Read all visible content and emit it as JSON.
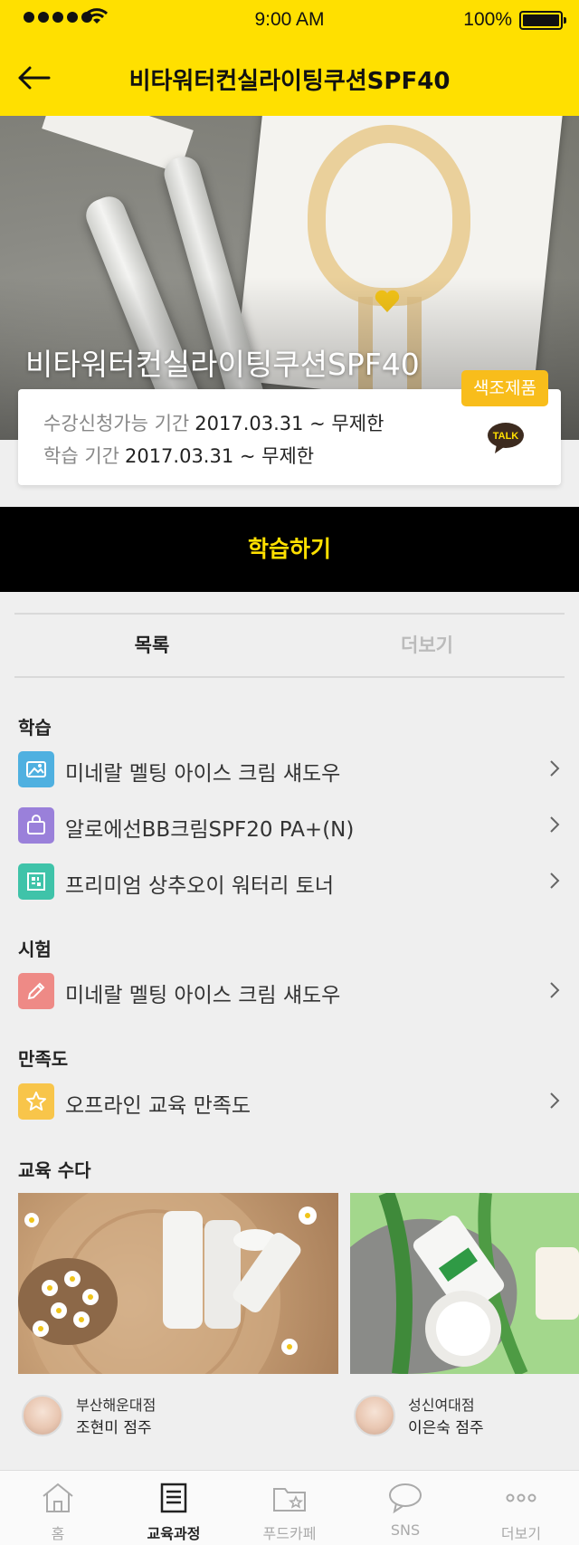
{
  "status_bar": {
    "time": "9:00 AM",
    "battery": "100%"
  },
  "nav": {
    "title": "비타워터컨실라이팅쿠션SPF40"
  },
  "hero": {
    "title": "비타워터컨실라이팅쿠션SPF40",
    "badge": "색조제품",
    "talk_label": "TALK"
  },
  "info": {
    "apply_period_label": "수강신청가능 기간",
    "apply_period_value": "2017.03.31 ~ 무제한",
    "study_period_label": "학습 기간",
    "study_period_value": "2017.03.31 ~ 무제한"
  },
  "cta": {
    "label": "학습하기"
  },
  "tabs": [
    {
      "label": "목록",
      "active": true
    },
    {
      "label": "더보기",
      "active": false
    }
  ],
  "sections": {
    "study": {
      "title": "학습",
      "items": [
        {
          "label": "미네랄 멜팅 아이스 크림 섀도우",
          "icon": "image-icon",
          "color": "#4fb0e0"
        },
        {
          "label": "알로에선BB크림SPF20 PA+(N)",
          "icon": "bag-icon",
          "color": "#9a80da"
        },
        {
          "label": "프리미엄 상추오이 워터리 토너",
          "icon": "qr-icon",
          "color": "#3fc3a9"
        }
      ]
    },
    "exam": {
      "title": "시험",
      "items": [
        {
          "label": "미네랄 멜팅 아이스 크림 섀도우",
          "icon": "pencil-icon",
          "color": "#ee8a86"
        }
      ]
    },
    "satisfaction": {
      "title": "만족도",
      "items": [
        {
          "label": "오프라인 교육 만족도",
          "icon": "star-icon",
          "color": "#f8c54a"
        }
      ]
    },
    "talk": {
      "title": "교육 수다",
      "posts": [
        {
          "store": "부산해운대점",
          "author": "조현미 점주"
        },
        {
          "store": "성신여대점",
          "author": "이은숙 점주"
        }
      ]
    }
  },
  "bottom_nav": [
    {
      "label": "홈",
      "icon": "home-icon",
      "active": false
    },
    {
      "label": "교육과정",
      "icon": "document-icon",
      "active": true
    },
    {
      "label": "푸드카페",
      "icon": "folder-star-icon",
      "active": false
    },
    {
      "label": "SNS",
      "icon": "chat-bubble-icon",
      "active": false
    },
    {
      "label": "더보기",
      "icon": "more-dots-icon",
      "active": false
    }
  ]
}
